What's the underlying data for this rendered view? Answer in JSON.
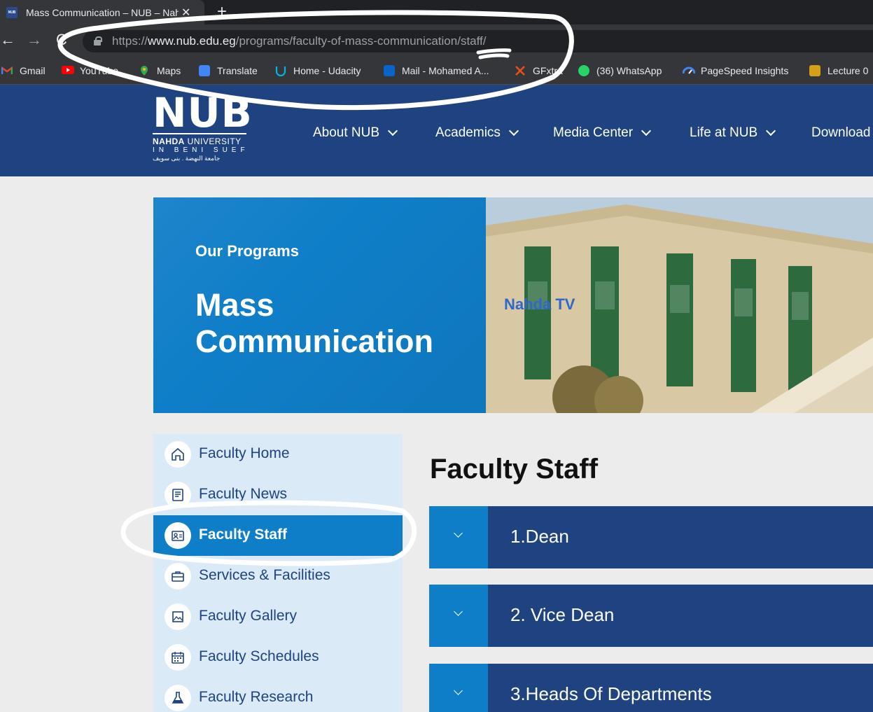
{
  "browser": {
    "tab": {
      "title": "Mass Communication – NUB – Nahda University",
      "favicon_label": "NUB",
      "close_glyph": "✕"
    },
    "new_tab_glyph": "+",
    "nav": {
      "back": "←",
      "forward": "→",
      "reload": "C"
    },
    "url": {
      "scheme": "https://",
      "host": "www.nub.edu.eg",
      "path": "/programs/faculty-of-mass-communication/staff/"
    },
    "bookmarks": [
      {
        "label": "Gmail",
        "icon": "gmail-icon",
        "color": "#ea4335"
      },
      {
        "label": "YouTube",
        "icon": "youtube-icon",
        "color": "#ff0000"
      },
      {
        "label": "Maps",
        "icon": "maps-icon",
        "color": "#34a853"
      },
      {
        "label": "Translate",
        "icon": "translate-icon",
        "color": "#4285f4"
      },
      {
        "label": "Home - Udacity",
        "icon": "udacity-icon",
        "color": "#02b3e4"
      },
      {
        "label": "Mail - Mohamed A...",
        "icon": "outlook-icon",
        "color": "#0a64c8"
      },
      {
        "label": "GFxtra",
        "icon": "gfxtra-icon",
        "color": "#e94e1b"
      },
      {
        "label": "(36) WhatsApp",
        "icon": "whatsapp-icon",
        "color": "#25d366"
      },
      {
        "label": "PageSpeed Insights",
        "icon": "pagespeed-icon",
        "color": "#4285f4"
      },
      {
        "label": "Lecture 0",
        "icon": "lecture-icon",
        "color": "#d4a017"
      }
    ]
  },
  "site": {
    "logo": {
      "mark": "NUB",
      "line1_bold": "NAHDA",
      "line1_rest": " UNIVERSITY",
      "line2": "IN BENI SUEF",
      "line3": "جامعة النهضة . بنى سويف"
    },
    "nav": [
      "About NUB",
      "Academics",
      "Media Center",
      "Life at NUB",
      "Download"
    ],
    "colors": {
      "header_bg": "#1f4381",
      "accent": "#0f7ec8",
      "sidebar_bg": "#daeaf6"
    }
  },
  "hero": {
    "kicker": "Our Programs",
    "title": "Mass Communication",
    "building_sign": "Nahda TV"
  },
  "sidebar": {
    "items": [
      {
        "label": "Faculty Home",
        "icon": "home-icon",
        "active": false
      },
      {
        "label": "Faculty News",
        "icon": "newspaper-icon",
        "active": false
      },
      {
        "label": "Faculty Staff",
        "icon": "id-card-icon",
        "active": true
      },
      {
        "label": "Services & Facilities",
        "icon": "briefcase-icon",
        "active": false
      },
      {
        "label": "Faculty Gallery",
        "icon": "gallery-icon",
        "active": false
      },
      {
        "label": "Faculty Schedules",
        "icon": "calendar-icon",
        "active": false
      },
      {
        "label": "Faculty Research",
        "icon": "flask-icon",
        "active": false
      }
    ]
  },
  "main": {
    "heading": "Faculty Staff",
    "accordions": [
      {
        "label": "1.Dean"
      },
      {
        "label": "2. Vice Dean"
      },
      {
        "label": "3.Heads Of Departments"
      }
    ]
  }
}
